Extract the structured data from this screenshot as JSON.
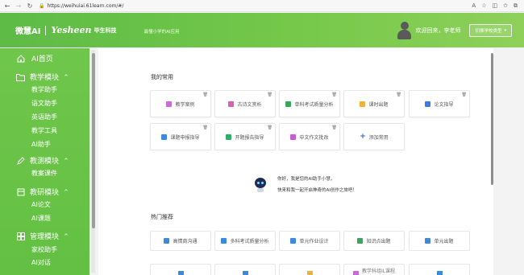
{
  "browser": {
    "url": "https://weihuiai.61learn.com/#/",
    "reader_label": "A",
    "icons": [
      "back-icon",
      "forward-icon",
      "refresh-icon",
      "lock-icon",
      "reader-icon",
      "star-icon",
      "split-icon",
      "favorites-icon",
      "collections-icon"
    ]
  },
  "header": {
    "brand_primary": "微慧AI",
    "brand_secondary": "Yesheen",
    "brand_secondary_cn": "毕生科技",
    "slogan": "最懂小学的AI应用",
    "welcome": "欢迎回来，李老师",
    "switch_label": "切换学校类型",
    "colors": {
      "gradient_start": "#5dbb46",
      "gradient_end": "#8ed05a"
    }
  },
  "sidebar": {
    "home": "AI首页",
    "groups": [
      {
        "label": "教学模块",
        "icon": "folder-icon",
        "items": [
          "教学助手",
          "语文助手",
          "英语助手",
          "教学工具",
          "AI助手"
        ]
      },
      {
        "label": "教测模块",
        "icon": "pen-icon",
        "items": [
          "教案课件"
        ]
      },
      {
        "label": "教研模块",
        "icon": "book-icon",
        "items": [
          "AI论文",
          "AI课题"
        ]
      },
      {
        "label": "管理模块",
        "icon": "grid-icon",
        "items": [
          "家校助手",
          "AI对话"
        ]
      }
    ],
    "color": "#66c246"
  },
  "favorites": {
    "title": "我的常用",
    "cards": [
      {
        "label": "教学案例",
        "icon_color": "#c86ad8"
      },
      {
        "label": "古诗文赏析",
        "icon_color": "#d95fb9"
      },
      {
        "label": "单科考试质量分析",
        "icon_color": "#3aa65a"
      },
      {
        "label": "课时出题",
        "icon_color": "#f0b234"
      },
      {
        "label": "论文指导",
        "icon_color": "#3a7be0"
      },
      {
        "label": "课题申报指导",
        "icon_color": "#3a8be0"
      },
      {
        "label": "开题报告指导",
        "icon_color": "#2fae6a"
      },
      {
        "label": "中文作文批改",
        "icon_color": "#c95bd6"
      }
    ],
    "add_label": "添加常用",
    "delete_icon": "trash-icon"
  },
  "assistant": {
    "line1": "你好，我是您的AI助手小慧，",
    "line2": "快来和我一起开启神奇的AI创作之旅吧！"
  },
  "hot": {
    "title": "热门推荐",
    "cards": [
      {
        "label": "高情商沟通",
        "icon_color": "#3a8be0"
      },
      {
        "label": "多科考试质量分析",
        "icon_color": "#3a8be0"
      },
      {
        "label": "单元作业设计",
        "icon_color": "#3a8be0"
      },
      {
        "label": "知识点出题",
        "icon_color": "#3aa65a"
      },
      {
        "label": "单元出题",
        "icon_color": "#3a8be0"
      }
    ],
    "partial_cards": [
      {
        "label": "",
        "icon_color": "#3a8be0"
      },
      {
        "label": "",
        "icon_color": "#3a8be0"
      },
      {
        "label": "",
        "icon_color": "#f0b234"
      },
      {
        "label": "教学科组IL课程",
        "icon_color": "#c86ad8"
      },
      {
        "label": "",
        "icon_color": "#3a8be0"
      }
    ]
  }
}
